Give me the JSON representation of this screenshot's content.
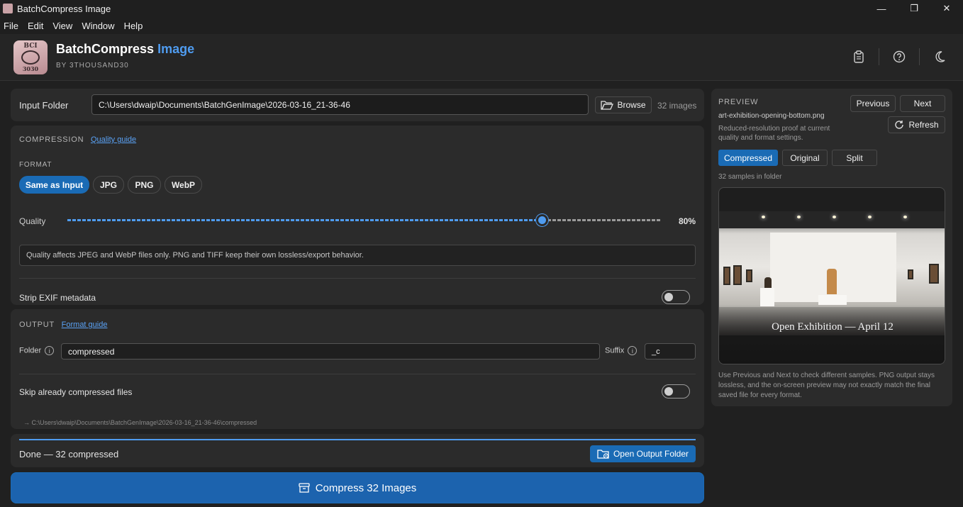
{
  "window": {
    "title": "BatchCompress Image",
    "minimize": "—",
    "maximize": "❐",
    "close": "✕"
  },
  "menu": [
    "File",
    "Edit",
    "View",
    "Window",
    "Help"
  ],
  "header": {
    "title_main": "BatchCompress",
    "title_accent": "Image",
    "subtitle": "BY 3THOUSAND30",
    "logo_top": "BCI",
    "logo_bottom": "3030",
    "accent_color": "#4f9cf0"
  },
  "input": {
    "label": "Input Folder",
    "path": "C:\\Users\\dwaip\\Documents\\BatchGenImage\\2026-03-16_21-36-46",
    "browse_label": "Browse",
    "count": "32 images"
  },
  "compression": {
    "title": "COMPRESSION",
    "guide_link": "Quality guide",
    "format_label": "FORMAT",
    "formats": [
      "Same as Input",
      "JPG",
      "PNG",
      "WebP"
    ],
    "selected_format": "Same as Input",
    "quality_label": "Quality",
    "quality_value": 80,
    "quality_text": "80%",
    "note": "Quality affects JPEG and WebP files only. PNG and TIFF keep their own lossless/export behavior.",
    "strip_exif_label": "Strip EXIF metadata",
    "strip_exif": false
  },
  "output": {
    "title": "OUTPUT",
    "guide_link": "Format guide",
    "folder_label": "Folder",
    "folder_value": "compressed",
    "suffix_label": "Suffix",
    "suffix_value": "_c",
    "skip_label": "Skip already compressed files",
    "skip": false,
    "path_preview": "→ C:\\Users\\dwaip\\Documents\\BatchGenImage\\2026-03-16_21-36-46\\compressed"
  },
  "status": {
    "text": "Done — 32 compressed",
    "progress": 1.0,
    "open_folder_label": "Open Output Folder"
  },
  "compress_button": {
    "label": "Compress 32 Images"
  },
  "preview": {
    "title": "PREVIEW",
    "filename": "art-exhibition-opening-bottom.png",
    "description": "Reduced-resolution proof at current quality and format settings.",
    "prev_label": "Previous",
    "next_label": "Next",
    "refresh_label": "Refresh",
    "modes": [
      "Compressed",
      "Original",
      "Split"
    ],
    "selected_mode": "Compressed",
    "samples": "32 samples in folder",
    "image_caption": "Open Exhibition — April 12",
    "footnote": "Use Previous and Next to check different samples. PNG output stays lossless, and the on-screen preview may not exactly match the final saved file for every format."
  }
}
